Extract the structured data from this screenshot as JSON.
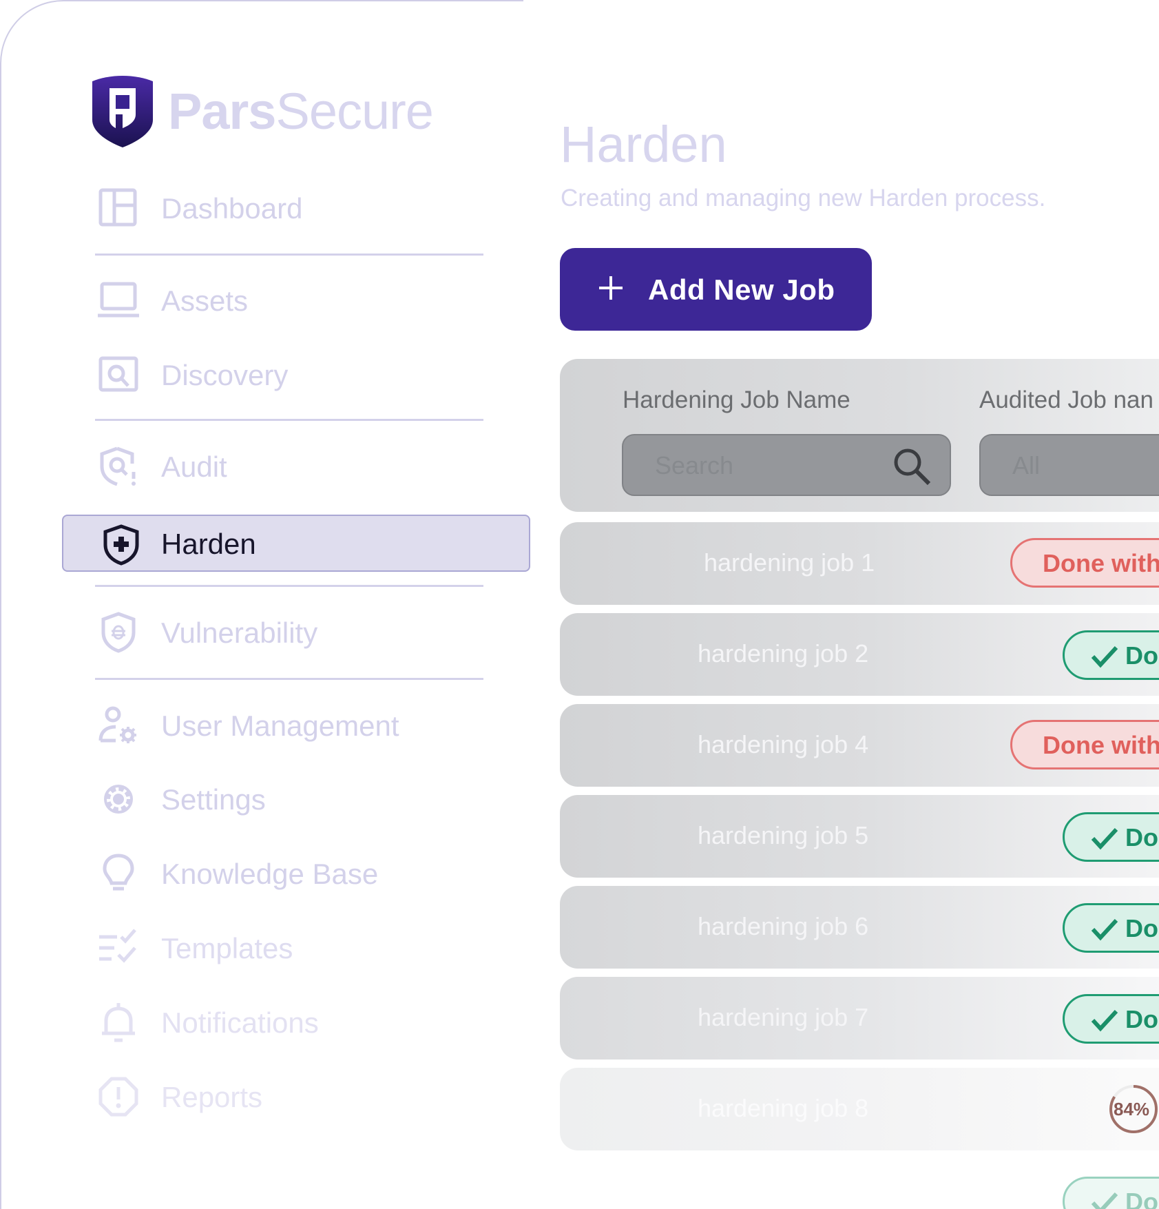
{
  "brand": {
    "part1": "Pars",
    "part2": "Secure"
  },
  "sidebar": {
    "items": [
      {
        "label": "Dashboard",
        "icon": "dashboard-icon"
      },
      {
        "label": "Assets",
        "icon": "laptop-icon"
      },
      {
        "label": "Discovery",
        "icon": "discovery-icon"
      },
      {
        "label": "Audit",
        "icon": "audit-shield-icon"
      },
      {
        "label": "Harden",
        "icon": "harden-shield-icon",
        "active": true
      },
      {
        "label": "Vulnerability",
        "icon": "bug-shield-icon"
      },
      {
        "label": "User Management",
        "icon": "user-gear-icon"
      },
      {
        "label": "Settings",
        "icon": "gear-icon"
      },
      {
        "label": "Knowledge Base",
        "icon": "lightbulb-icon"
      },
      {
        "label": "Templates",
        "icon": "checklist-icon"
      },
      {
        "label": "Notifications",
        "icon": "bell-icon"
      },
      {
        "label": "Reports",
        "icon": "alert-octagon-icon"
      }
    ]
  },
  "main": {
    "title": "Harden",
    "subtitle": "Creating and managing new Harden process.",
    "add_button": "Add New Job",
    "filters": {
      "col1_header": "Hardening Job Name",
      "col2_header": "Audited Job nan",
      "search_placeholder": "Search",
      "select_value": "All"
    },
    "jobs": [
      {
        "name": "hardening job 1",
        "status": "Done with",
        "status_type": "warn"
      },
      {
        "name": "hardening job 2",
        "status": "Do",
        "status_type": "ok"
      },
      {
        "name": "hardening job 4",
        "status": "Done with",
        "status_type": "warn"
      },
      {
        "name": "hardening job 5",
        "status": "Do",
        "status_type": "ok"
      },
      {
        "name": "hardening job 6",
        "status": "Do",
        "status_type": "ok"
      },
      {
        "name": "hardening job 7",
        "status": "Do",
        "status_type": "ok"
      },
      {
        "name": "hardening job 8",
        "progress": "84%",
        "progress_value": 0.84
      },
      {
        "status": "Do",
        "status_type": "ok"
      }
    ]
  },
  "colors": {
    "primary": "#3d2796",
    "active_bg": "#dfddee",
    "warn": "#e0605c",
    "ok": "#1a8f68"
  }
}
